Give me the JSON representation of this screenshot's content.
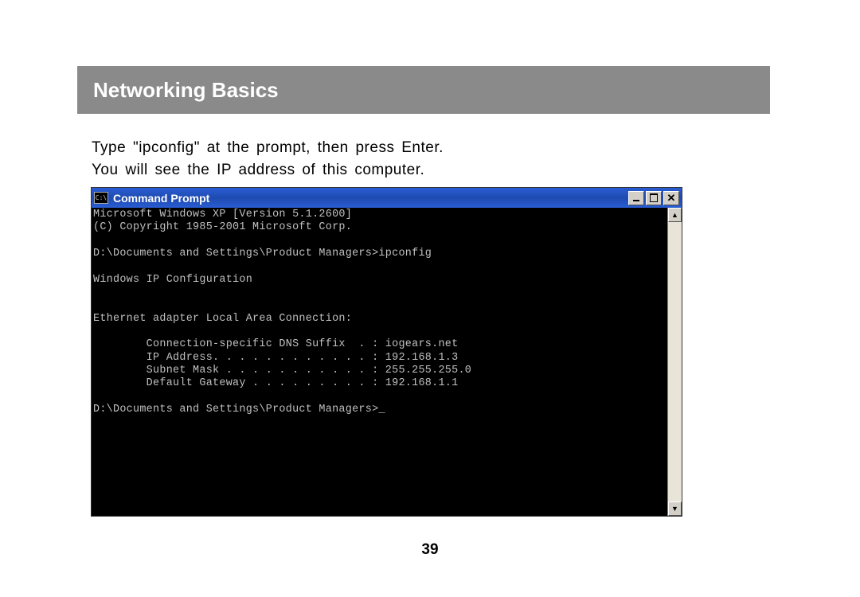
{
  "header": {
    "title": "Networking Basics"
  },
  "instructions": {
    "line1": "Type \"ipconfig\" at the prompt, then press Enter.",
    "line2": "You will see the IP address of this computer."
  },
  "cmd": {
    "icon_text": "C:\\",
    "title": "Command Prompt",
    "close_glyph": "✕",
    "scroll_up_glyph": "▲",
    "scroll_down_glyph": "▼",
    "output": "Microsoft Windows XP [Version 5.1.2600]\n(C) Copyright 1985-2001 Microsoft Corp.\n\nD:\\Documents and Settings\\Product Managers>ipconfig\n\nWindows IP Configuration\n\n\nEthernet adapter Local Area Connection:\n\n        Connection-specific DNS Suffix  . : iogears.net\n        IP Address. . . . . . . . . . . . : 192.168.1.3\n        Subnet Mask . . . . . . . . . . . : 255.255.255.0\n        Default Gateway . . . . . . . . . : 192.168.1.1\n\nD:\\Documents and Settings\\Product Managers>_"
  },
  "page": {
    "number": "39"
  }
}
